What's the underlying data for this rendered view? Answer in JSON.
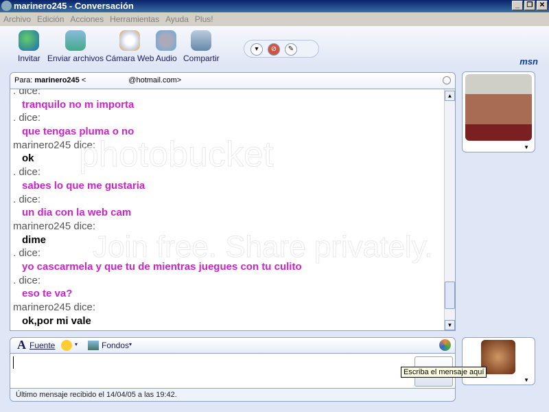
{
  "window": {
    "title": "marinero245 - Conversación",
    "buttons": [
      "_",
      "❐",
      "✕"
    ]
  },
  "menu": [
    "Archivo",
    "Edición",
    "Acciones",
    "Herramientas",
    "Ayuda",
    "Plus!"
  ],
  "toolbar": {
    "items": [
      "Invitar",
      "Enviar archivos",
      "Cámara Web",
      "Audio",
      "Compartir"
    ],
    "logo": "msn"
  },
  "to": {
    "label": "Para:",
    "name": "marinero245",
    "email_prefix": "<",
    "email_suffix": "@hotmail.com>"
  },
  "chat": [
    {
      "who": ". dice:",
      "text": "tranquilo no m importa",
      "color": "#cc22cc"
    },
    {
      "who": ". dice:",
      "text": "que tengas pluma o no",
      "color": "#cc22cc"
    },
    {
      "who": "marinero245 dice:",
      "text": "ok",
      "color": "#000000"
    },
    {
      "who": ". dice:",
      "text": "sabes lo que me gustaria",
      "color": "#cc22cc"
    },
    {
      "who": ". dice:",
      "text": "un dia con la web cam",
      "color": "#cc22cc"
    },
    {
      "who": "marinero245 dice:",
      "text": "dime",
      "color": "#000000"
    },
    {
      "who": ". dice:",
      "text": "yo cascarmela y que tu de mientras juegues con tu culito",
      "color": "#cc22cc"
    },
    {
      "who": ". dice:",
      "text": "eso te va?",
      "color": "#cc22cc"
    },
    {
      "who": "marinero245 dice:",
      "text": "ok,por mi vale",
      "color": "#000000"
    }
  ],
  "input": {
    "font_label": "Fuente",
    "backgrounds_label": "Fondos",
    "tooltip": "Escriba el mensaje aquí"
  },
  "status": "Último mensaje recibido el 14/04/05 a las 19:42.",
  "watermark": [
    "photobucket",
    "Join free. Share privately."
  ]
}
